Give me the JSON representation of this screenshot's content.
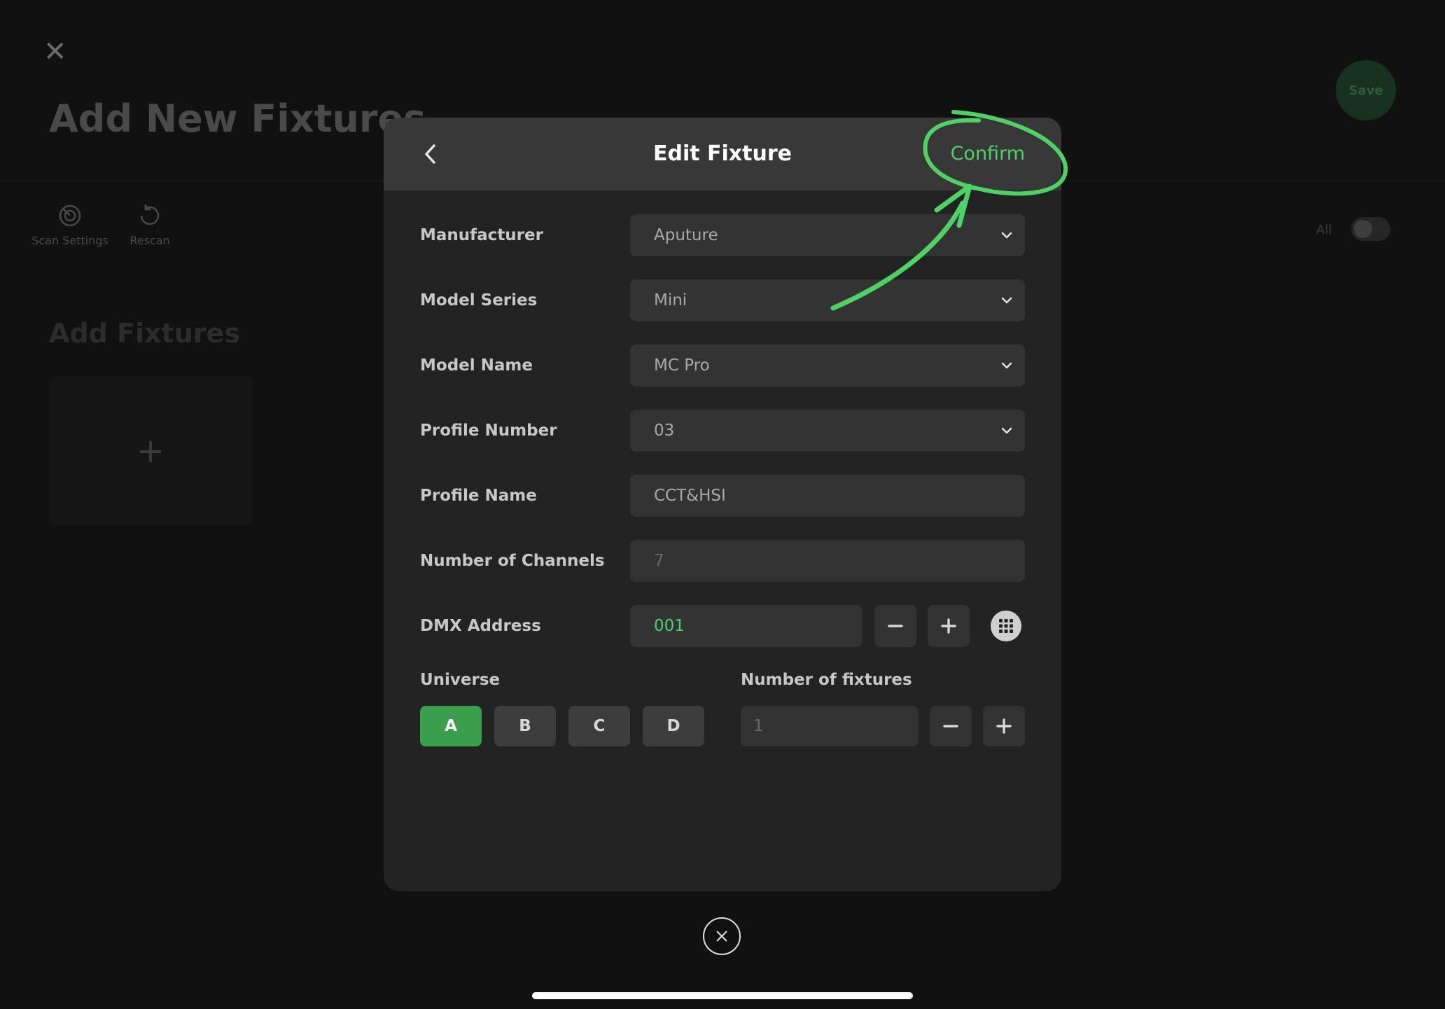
{
  "background": {
    "title": "Add New Fixtures",
    "save_label": "Save",
    "tools": [
      {
        "label": "Scan Settings",
        "icon": "scan-settings-icon"
      },
      {
        "label": "Rescan",
        "icon": "rescan-icon"
      }
    ],
    "all_label": "All",
    "section_title": "Add Fixtures",
    "add_card_symbol": "+"
  },
  "modal": {
    "title": "Edit Fixture",
    "confirm_label": "Confirm",
    "manufacturer": {
      "label": "Manufacturer",
      "value": "Aputure"
    },
    "model_series": {
      "label": "Model Series",
      "value": "Mini"
    },
    "model_name": {
      "label": "Model Name",
      "value": "MC Pro"
    },
    "profile_number": {
      "label": "Profile Number",
      "value": "03"
    },
    "profile_name": {
      "label": "Profile Name",
      "value": "CCT&HSI"
    },
    "channels": {
      "label": "Number of Channels",
      "value": "7"
    },
    "dmx": {
      "label": "DMX Address",
      "value": "001"
    },
    "universe": {
      "label": "Universe",
      "options": [
        "A",
        "B",
        "C",
        "D"
      ],
      "selected": "A"
    },
    "fixtures_count": {
      "label": "Number of fixtures",
      "value": "1"
    }
  },
  "colors": {
    "accent": "#4cd364",
    "selected_universe": "#3a9f4d",
    "modal_bg": "#232323",
    "header_bg": "#383838",
    "field_bg": "#333333"
  }
}
